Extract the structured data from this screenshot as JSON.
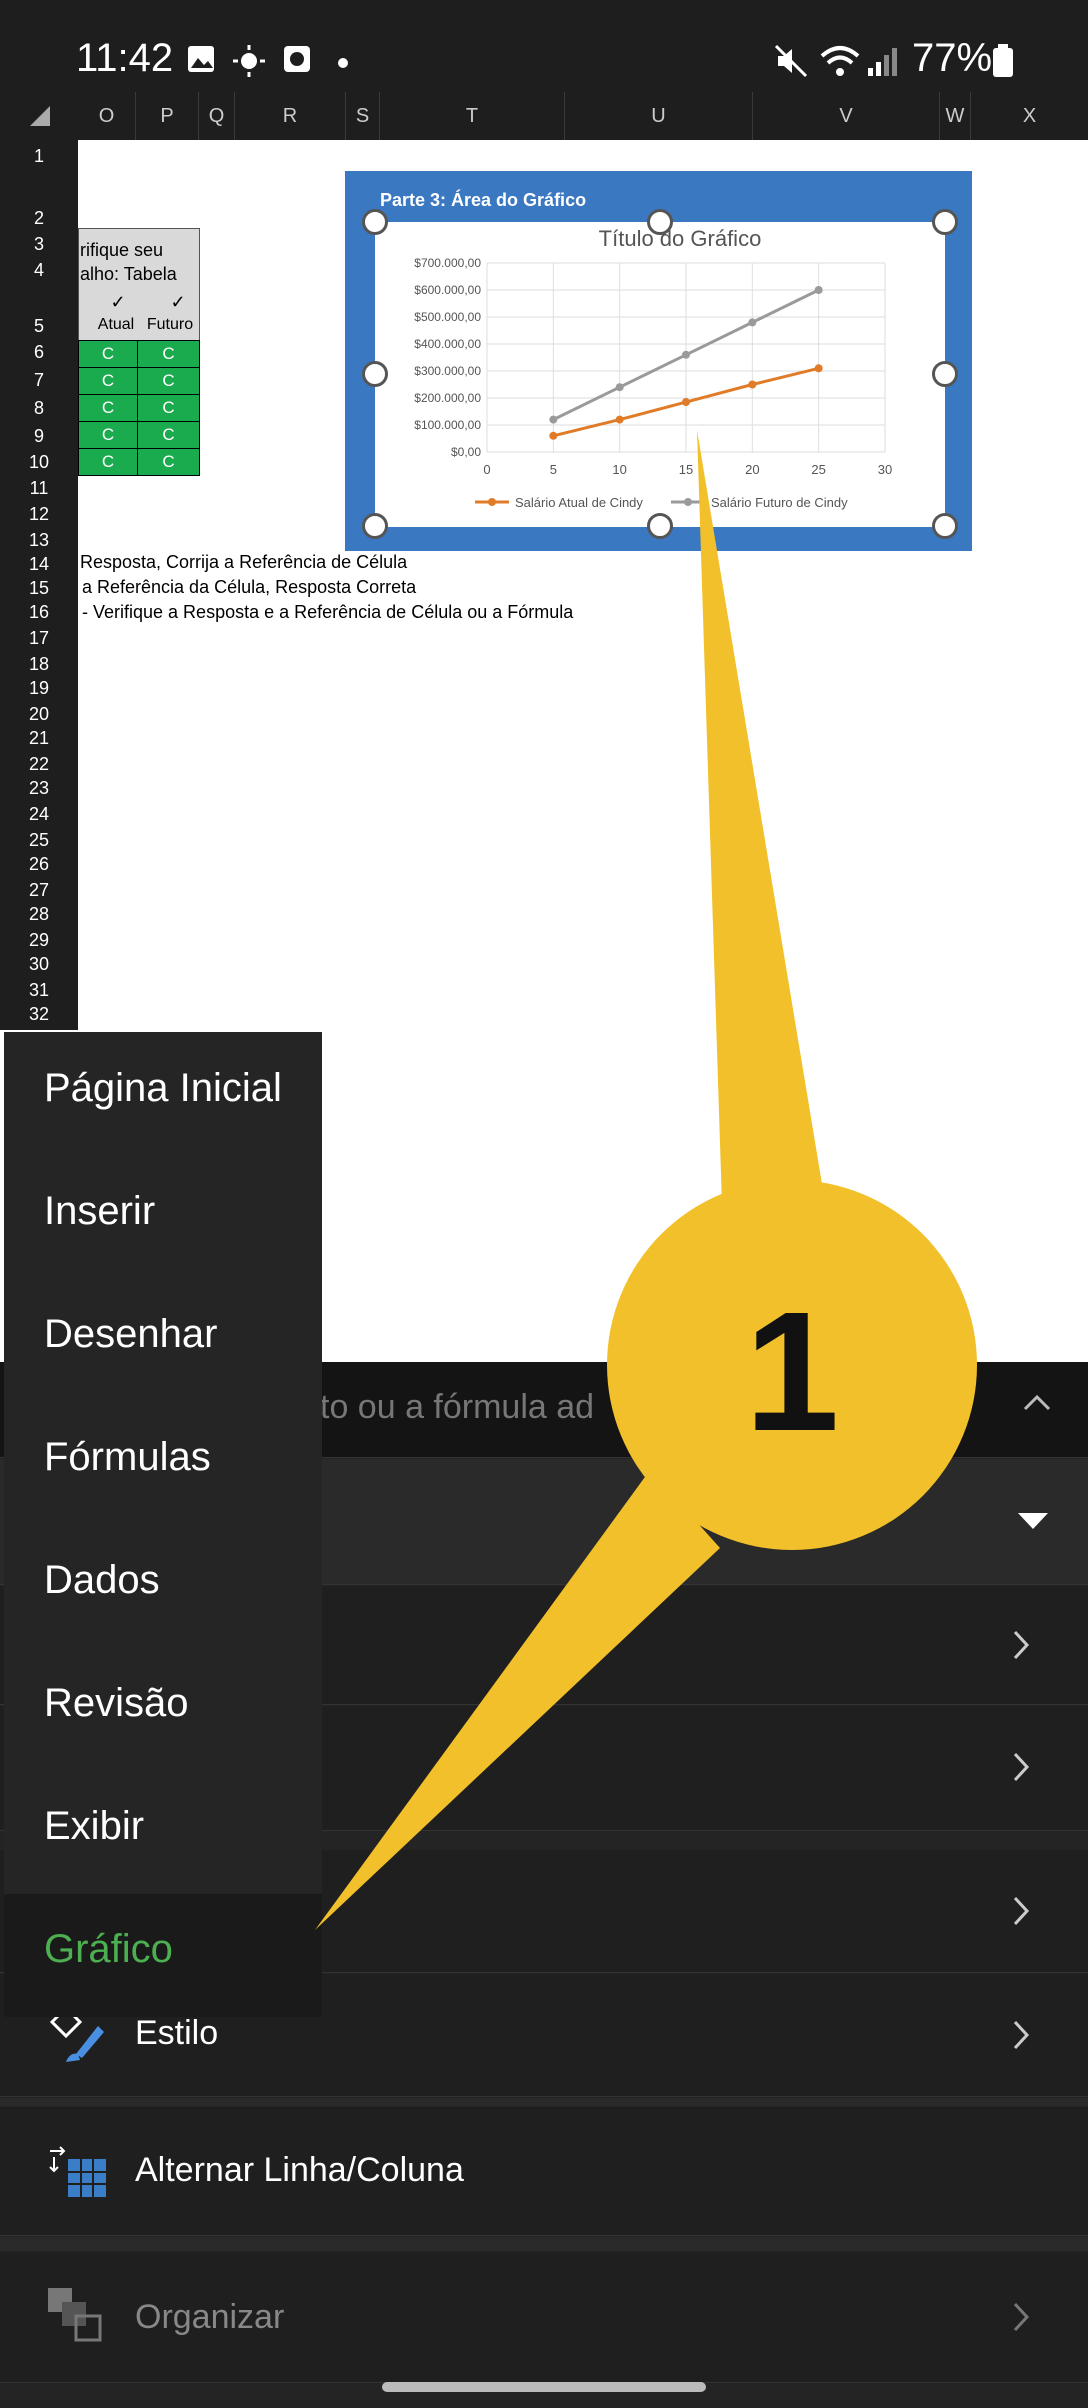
{
  "status_bar": {
    "time": "11:42",
    "battery": "77%"
  },
  "columns": [
    "O",
    "P",
    "Q",
    "R",
    "S",
    "T",
    "U",
    "V",
    "W",
    "X"
  ],
  "rows": [
    "1",
    "2",
    "3",
    "4",
    "5",
    "6",
    "7",
    "8",
    "9",
    "10",
    "11",
    "12",
    "13",
    "14",
    "15",
    "16",
    "17",
    "18",
    "19",
    "20",
    "21",
    "22",
    "23",
    "24",
    "25",
    "26",
    "27",
    "28",
    "29",
    "30",
    "31",
    "32"
  ],
  "sheet": {
    "verify_line1": "rifique seu",
    "verify_line2": "alho: Tabela",
    "check_mark": "✓",
    "col_atual": "Atual",
    "col_futuro": "Futuro",
    "grade": "C",
    "note1": "Resposta, Corrija a Referência de Célula",
    "note2": "a Referência da Célula, Resposta Correta",
    "note3": "- Verifique a Resposta e a Referência de Célula ou a Fórmula"
  },
  "chart_header": "Parte 3: Área do Gráfico",
  "chart_data": {
    "type": "line",
    "title": "Título do Gráfico",
    "x": [
      5,
      10,
      15,
      20,
      25
    ],
    "xlim": [
      0,
      30
    ],
    "x_ticks": [
      "0",
      "5",
      "10",
      "15",
      "20",
      "25",
      "30"
    ],
    "ylim": [
      0,
      700000
    ],
    "y_ticks": [
      "$0,00",
      "$100.000,00",
      "$200.000,00",
      "$300.000,00",
      "$400.000,00",
      "$500.000,00",
      "$600.000,00",
      "$700.000,00"
    ],
    "series": [
      {
        "name": "Salário Atual de Cindy",
        "values": [
          60000,
          120000,
          185000,
          250000,
          310000
        ],
        "color": "#e07b28"
      },
      {
        "name": "Salário Futuro de Cindy",
        "values": [
          120000,
          240000,
          360000,
          480000,
          600000
        ],
        "color": "#9a9a9a"
      }
    ],
    "grid": true,
    "legend": "bottom"
  },
  "formula_bar_placeholder": "to ou a fórmula ad",
  "callout_number": "1",
  "menu": {
    "items": [
      "Página Inicial",
      "Inserir",
      "Desenhar",
      "Fórmulas",
      "Dados",
      "Revisão",
      "Exibir",
      "Gráfico"
    ],
    "active": "Gráfico",
    "active_color": "#4caf50"
  },
  "panel": {
    "estilo": "Estilo",
    "alternar": "Alternar Linha/Coluna",
    "organizar": "Organizar"
  }
}
